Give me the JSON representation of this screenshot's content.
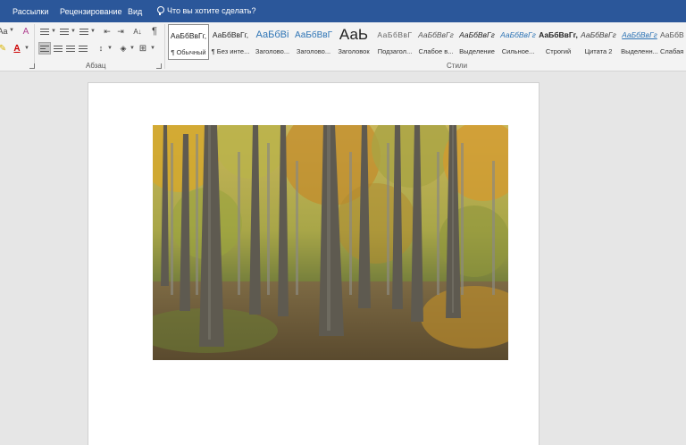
{
  "menu": {
    "tabs": [
      {
        "label": "Рассылки"
      },
      {
        "label": "Рецензирование"
      },
      {
        "label": "Вид"
      }
    ],
    "tell_me": "Что вы хотите сделать?"
  },
  "ribbon": {
    "paragraph_group_label": "Абзац",
    "styles_group_label": "Стили",
    "styles": [
      {
        "preview": "АаБбВвГг,",
        "name": "¶ Обычный"
      },
      {
        "preview": "АаБбВвГг,",
        "name": "¶ Без инте..."
      },
      {
        "preview": "АаБбВі",
        "name": "Заголово..."
      },
      {
        "preview": "АаБбВвГ",
        "name": "Заголово..."
      },
      {
        "preview": "АаЬ",
        "name": "Заголовок"
      },
      {
        "preview": "АаБбВвГ",
        "name": "Подзагол..."
      },
      {
        "preview": "АаБбВвГг",
        "name": "Слабое в..."
      },
      {
        "preview": "АаБбВвГг",
        "name": "Выделение"
      },
      {
        "preview": "АаБбВвГг",
        "name": "Сильное..."
      },
      {
        "preview": "АаБбВвГг,",
        "name": "Строгий"
      },
      {
        "preview": "АаБбВвГг",
        "name": "Цитата 2"
      },
      {
        "preview": "АаБбВвГг",
        "name": "Выделенн..."
      },
      {
        "preview": "АаБбВ",
        "name": "Слабая"
      }
    ]
  },
  "colors": {
    "title_bar": "#2b579a",
    "ribbon_bg": "#f3f3f3",
    "workspace_bg": "#e6e6e6",
    "page_bg": "#ffffff"
  }
}
